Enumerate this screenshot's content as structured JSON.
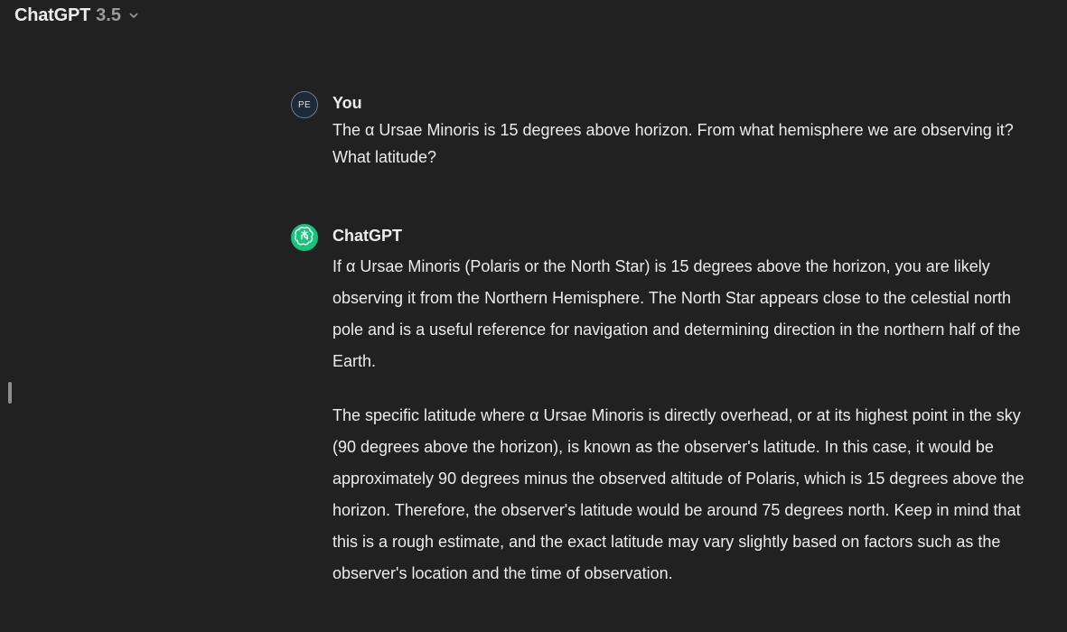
{
  "header": {
    "model_name": "ChatGPT",
    "model_version": "3.5",
    "dropdown_icon": "chevron-down-icon"
  },
  "conversation": {
    "user_message": {
      "avatar_initials": "PE",
      "author": "You",
      "text": "The α Ursae Minoris is 15 degrees above horizon. From what hemisphere we are observing it? What latitude?"
    },
    "assistant_message": {
      "avatar_icon": "openai-logo-icon",
      "avatar_color": "#19c37d",
      "author": "ChatGPT",
      "paragraphs": [
        "If α Ursae Minoris (Polaris or the North Star) is 15 degrees above the horizon, you are likely observing it from the Northern Hemisphere. The North Star appears close to the celestial north pole and is a useful reference for navigation and determining direction in the northern half of the Earth.",
        "The specific latitude where α Ursae Minoris is directly overhead, or at its highest point in the sky (90 degrees above the horizon), is known as the observer's latitude. In this case, it would be approximately 90 degrees minus the observed altitude of Polaris, which is 15 degrees above the horizon. Therefore, the observer's latitude would be around 75 degrees north. Keep in mind that this is a rough estimate, and the exact latitude may vary slightly based on factors such as the observer's location and the time of observation."
      ]
    }
  },
  "colors": {
    "background": "#212121",
    "text": "#ececec",
    "muted": "#9b9b9b"
  }
}
